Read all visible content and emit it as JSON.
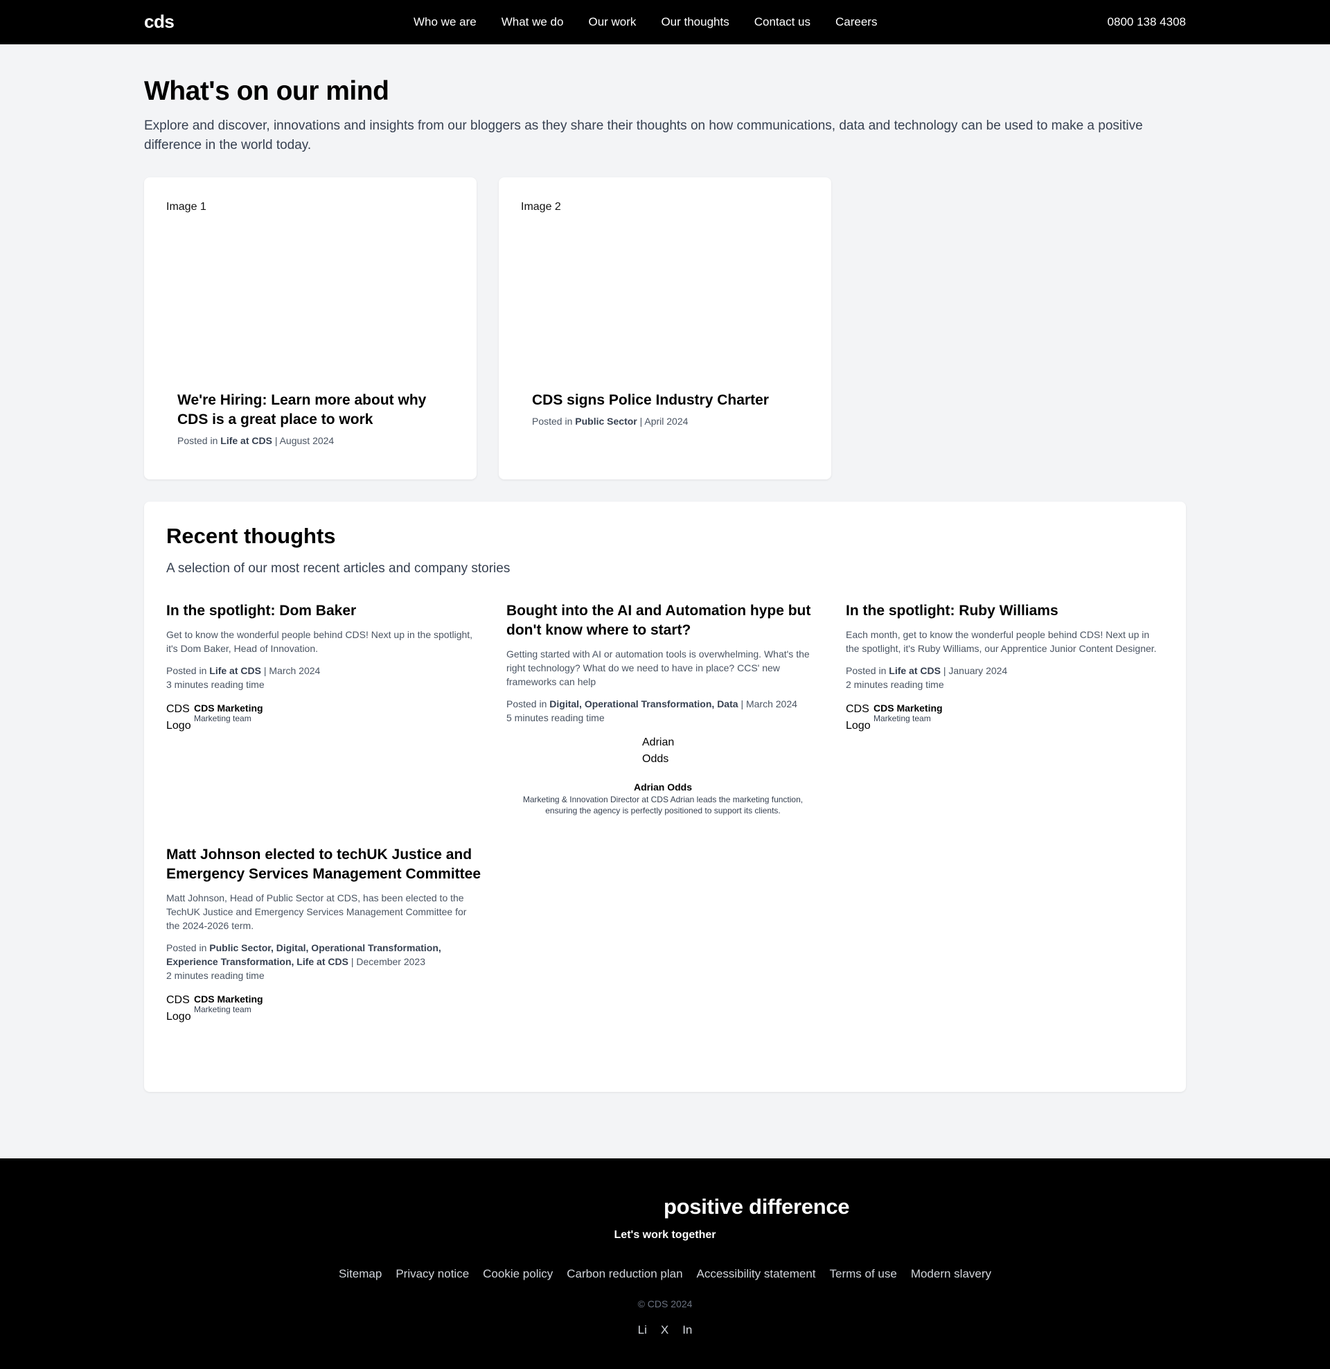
{
  "header": {
    "logo": "cds",
    "nav": [
      "Who we are",
      "What we do",
      "Our work",
      "Our thoughts",
      "Contact us",
      "Careers"
    ],
    "phone": "0800 138 4308"
  },
  "hero": {
    "title": "What's on our mind",
    "intro": "Explore and discover, innovations and insights from our bloggers as they share their thoughts on how communications, data and technology can be used to make a positive difference in the world today."
  },
  "featured": [
    {
      "image_label": "Image 1",
      "title": "We're Hiring: Learn more about why CDS is a great place to work",
      "posted_in": "Posted in",
      "category": "Life at CDS",
      "date": "| August 2024"
    },
    {
      "image_label": "Image 2",
      "title": "CDS signs Police Industry Charter",
      "posted_in": "Posted in",
      "category": "Public Sector",
      "date": "| April 2024"
    }
  ],
  "recent": {
    "title": "Recent thoughts",
    "subtitle": "A selection of our most recent articles and company stories",
    "articles": [
      {
        "title": "In the spotlight: Dom Baker",
        "excerpt": "Get to know the wonderful people behind CDS! Next up in the spotlight, it's Dom Baker, Head of Innovation.",
        "posted_in": "Posted in",
        "categories": "Life at CDS",
        "date": "| March 2024",
        "reading_time": "3 minutes reading time",
        "author_logo": "CDS Logo",
        "author_name": "CDS Marketing",
        "author_role": "Marketing team"
      },
      {
        "title": "Bought into the AI and Automation hype but don't know where to start?",
        "excerpt": "Getting started with AI or automation tools is overwhelming. What's the right technology? What do we need to have in place? CCS' new frameworks can help",
        "posted_in": "Posted in",
        "categories": "Digital, Operational Transformation, Data",
        "date": "| March 2024",
        "reading_time": "5 minutes reading time",
        "author_photo": "Adrian Odds",
        "author_name": "Adrian Odds",
        "author_bio": "Marketing & Innovation Director at CDS Adrian leads the marketing function, ensuring the agency is perfectly positioned to support its clients."
      },
      {
        "title": "In the spotlight: Ruby Williams",
        "excerpt": "Each month, get to know the wonderful people behind CDS! Next up in the spotlight, it's Ruby Williams, our Apprentice Junior Content Designer.",
        "posted_in": "Posted in",
        "categories": "Life at CDS",
        "date": "| January 2024",
        "reading_time": "2 minutes reading time",
        "author_logo": "CDS Logo",
        "author_name": "CDS Marketing",
        "author_role": "Marketing team"
      },
      {
        "title": "Matt Johnson elected to techUK Justice and Emergency Services Management Committee",
        "excerpt": "Matt Johnson, Head of Public Sector at CDS, has been elected to the TechUK Justice and Emergency Services Management Committee for the 2024-2026 term.",
        "posted_in": "Posted in",
        "categories": "Public Sector, Digital, Operational Transformation, Experience Transformation, Life at CDS",
        "date": "| December 2023",
        "reading_time": "2 minutes reading time",
        "author_logo": "CDS Logo",
        "author_name": "CDS Marketing",
        "author_role": "Marketing team"
      }
    ]
  },
  "footer": {
    "tagline": "positive difference",
    "cta": "Let's work together",
    "links": [
      "Sitemap",
      "Privacy notice",
      "Cookie policy",
      "Carbon reduction plan",
      "Accessibility statement",
      "Terms of use",
      "Modern slavery"
    ],
    "copyright": "© CDS 2024",
    "social": [
      "Li",
      "X",
      "In"
    ]
  }
}
